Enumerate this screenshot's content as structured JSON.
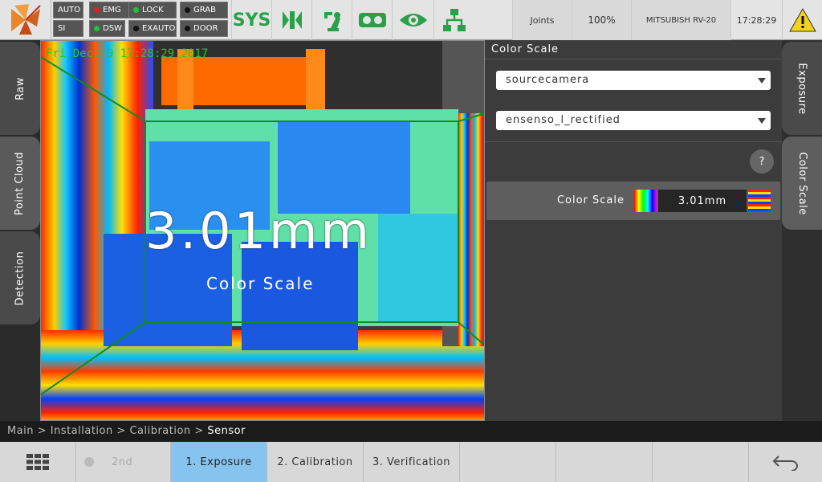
{
  "topbar": {
    "status": [
      {
        "label": "AUTO",
        "dot": ""
      },
      {
        "label": "EMG",
        "dot": "#e02020"
      },
      {
        "label": "LOCK",
        "dot": "#22c03a"
      },
      {
        "label": "GRAB",
        "dot": "#111111"
      },
      {
        "label": "SI",
        "dot": ""
      },
      {
        "label": "DSW",
        "dot": "#22c03a"
      },
      {
        "label": "EXAUTO",
        "dot": "#111111"
      },
      {
        "label": "DOOR",
        "dot": "#111111"
      }
    ],
    "sys_label": "SYS",
    "joints_label": "Joints",
    "speed_label": "100%",
    "robot_label": "MITSUBISH RV-20",
    "clock": "17:28:29",
    "accent": "#2aa048"
  },
  "left_tabs": [
    "Raw",
    "Point Cloud",
    "Detection"
  ],
  "right_tabs": [
    "Exposure",
    "Color Scale"
  ],
  "image": {
    "timestamp": "Fri Dec. 9 17:28:29 2017",
    "overlay_value": "3.01mm",
    "overlay_label": "Color Scale"
  },
  "panel": {
    "title": "Color Scale",
    "select1": "sourcecamera",
    "select2": "ensenso_l_rectified",
    "help": "?",
    "row_label": "Color Scale",
    "row_value": "3.01mm"
  },
  "breadcrumb": {
    "items": [
      "Main",
      "Installation",
      "Calibration"
    ],
    "separator": ">",
    "current": "Sensor"
  },
  "bottom": {
    "second_label": "2nd",
    "steps": [
      "1. Exposure",
      "2. Calibration",
      "3. Verification"
    ],
    "active_color": "#86c3ee"
  }
}
